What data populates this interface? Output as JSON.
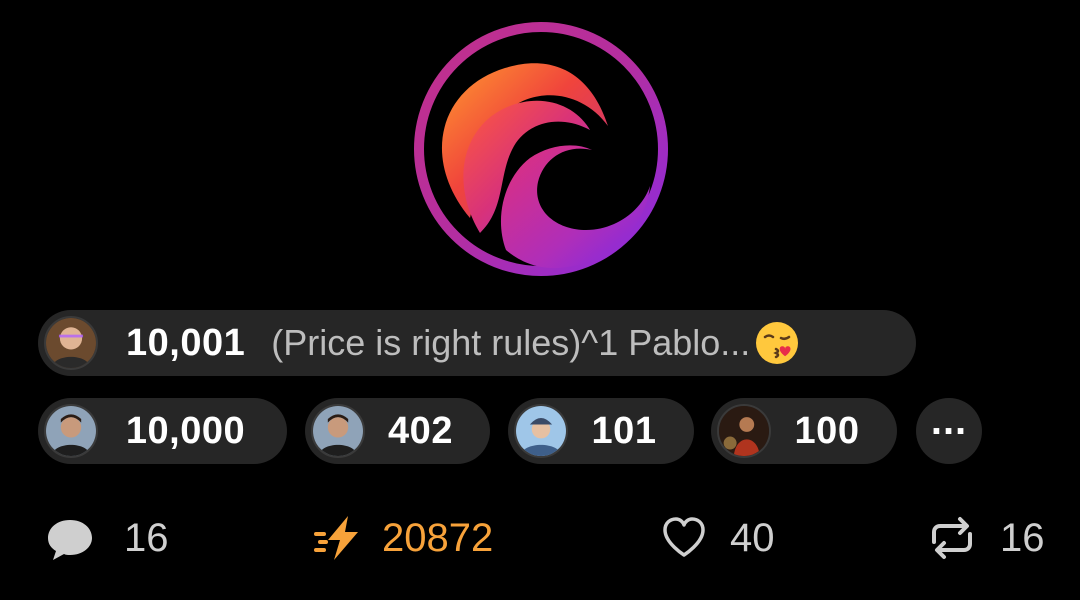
{
  "colors": {
    "accent": "#f7a23a",
    "pill_bg": "#262626",
    "text_muted": "#bdbdbd"
  },
  "logo": {
    "icon": "nostr-wave-logo-icon"
  },
  "top_zap": {
    "avatar": "user-avatar-icon",
    "amount": "10,001",
    "comment": "(Price is right rules)^1 Pablo...",
    "emoji": "kissing-face-emoji-icon"
  },
  "zaps": [
    {
      "avatar": "user-avatar-icon",
      "amount": "10,000"
    },
    {
      "avatar": "user-avatar-icon",
      "amount": "402"
    },
    {
      "avatar": "user-avatar-icon",
      "amount": "101"
    },
    {
      "avatar": "user-avatar-icon",
      "amount": "100"
    }
  ],
  "more_label": "...",
  "actions": {
    "reply_count": "16",
    "zap_total": "20872",
    "like_count": "40",
    "repost_count": "16"
  }
}
